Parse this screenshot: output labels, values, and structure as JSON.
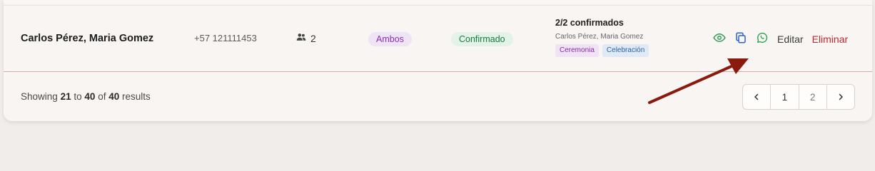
{
  "row": {
    "name": "Carlos Pérez, Maria Gomez",
    "phone": "+57 121111453",
    "guests_count": "2",
    "side_badge": "Ambos",
    "status_badge": "Confirmado",
    "confirmed_summary": "2/2 confirmados",
    "confirmed_names": "Carlos Pérez, Maria Gomez",
    "events": [
      "Ceremonia",
      "Celebración"
    ],
    "actions": {
      "view_icon": "eye-icon",
      "copy_icon": "copy-icon",
      "whatsapp_icon": "whatsapp-icon",
      "edit_label": "Editar",
      "delete_label": "Eliminar"
    }
  },
  "footer": {
    "showing": "Showing",
    "from": "21",
    "to_word": "to",
    "to": "40",
    "of_word": "of",
    "total": "40",
    "results_word": "results"
  },
  "pagination": {
    "prev_icon": "chevron-left-icon",
    "pages": [
      "1",
      "2"
    ],
    "next_icon": "chevron-right-icon"
  },
  "colors": {
    "background": "#f1edea",
    "card": "#f8f5f2",
    "confirm_green": "#187a3c",
    "ambos_purple": "#8b2fb0",
    "delete_red": "#c0272d",
    "annotation_arrow": "#8b1a0e"
  }
}
